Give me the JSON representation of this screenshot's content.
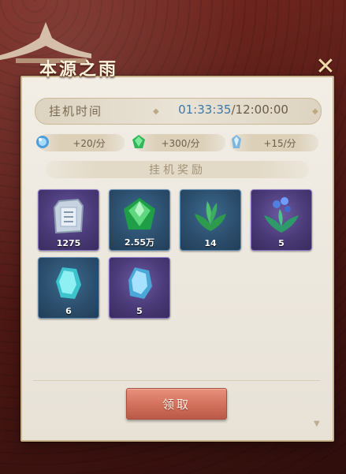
{
  "dialog": {
    "title": "本源之雨",
    "close_icon": "close-icon",
    "idle_time": {
      "label": "挂机时间",
      "current": "01:33:35",
      "separator": "/",
      "total": "12:00:00"
    },
    "rates": [
      {
        "icon": "blue-orb-icon",
        "text": "+20/分"
      },
      {
        "icon": "green-gem-icon",
        "text": "+300/分"
      },
      {
        "icon": "crystal-icon",
        "text": "+15/分"
      }
    ],
    "section_title": "挂机奖励",
    "rewards": [
      {
        "icon": "silver-tablet-icon",
        "qty": "1275",
        "rarity": "purple"
      },
      {
        "icon": "green-gem-icon",
        "qty": "2.55万",
        "rarity": "blue"
      },
      {
        "icon": "green-herb-icon",
        "qty": "14",
        "rarity": "blue"
      },
      {
        "icon": "blue-flower-herb-icon",
        "qty": "5",
        "rarity": "purple"
      },
      {
        "icon": "teal-crystal-icon",
        "qty": "6",
        "rarity": "blue"
      },
      {
        "icon": "blue-crystal-icon",
        "qty": "5",
        "rarity": "purple"
      }
    ],
    "claim_label": "领取"
  },
  "colors": {
    "purple_slot": "#4a3a78",
    "blue_slot": "#2c4f6e",
    "claim_button": "#cf6d58",
    "time_current": "#3c78a8"
  }
}
